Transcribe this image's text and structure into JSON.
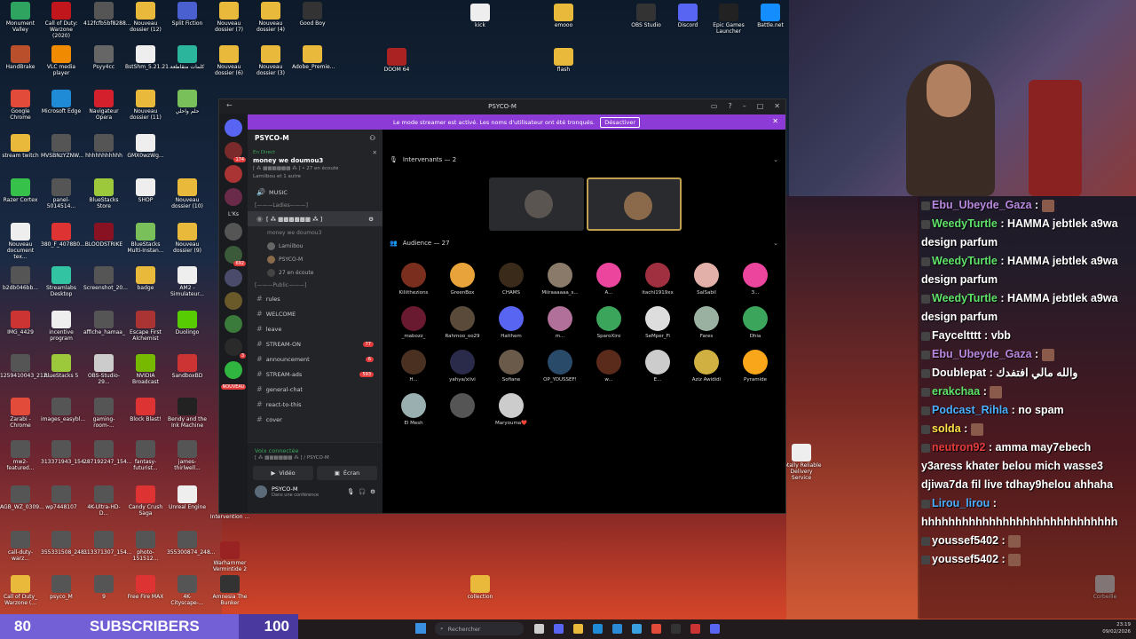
{
  "desktop_icons": [
    {
      "label": "Monument Valley",
      "color": "#2fa360"
    },
    {
      "label": "Call of Duty: Warzone (2020)",
      "color": "#c0161c"
    },
    {
      "label": "412fcfb5bf8288...",
      "color": "#555"
    },
    {
      "label": "Nouveau dossier (12)",
      "color": "#e8b93a"
    },
    {
      "label": "Split Fiction",
      "color": "#4a5fd0"
    },
    {
      "label": "Nouveau dossier (7)",
      "color": "#e8b93a"
    },
    {
      "label": "Nouveau dossier (4)",
      "color": "#e8b93a"
    },
    {
      "label": "Good Boy",
      "color": "#333"
    },
    {
      "label": "HandBrake",
      "color": "#b9502b"
    },
    {
      "label": "VLC media player",
      "color": "#f08a00"
    },
    {
      "label": "Psyy4cc",
      "color": "#666"
    },
    {
      "label": "BstShm_5.21.21...",
      "color": "#eee"
    },
    {
      "label": "كلمات متقاطعة",
      "color": "#2ab59c"
    },
    {
      "label": "Nouveau dossier (6)",
      "color": "#e8b93a"
    },
    {
      "label": "Nouveau dossier (3)",
      "color": "#e8b93a"
    },
    {
      "label": "Adobe_Premie...",
      "color": "#e8b93a"
    },
    {
      "label": "Google Chrome",
      "color": "#e24b3a"
    },
    {
      "label": "Microsoft Edge",
      "color": "#1f8ad6"
    },
    {
      "label": "Navigateur Opera",
      "color": "#d3202c"
    },
    {
      "label": "Nouveau dossier (11)",
      "color": "#e8b93a"
    },
    {
      "label": "حلم واحلي",
      "color": "#7ac05a"
    },
    {
      "label": "stream twitch",
      "color": "#e8b93a"
    },
    {
      "label": "MVSBNzYZNW...",
      "color": "#555"
    },
    {
      "label": "hhhhhhhhhhh",
      "color": "#555"
    },
    {
      "label": "GMX0wzWg...",
      "color": "#eee"
    },
    {
      "label": "Razer Cortex",
      "color": "#36c24a"
    },
    {
      "label": "panel-5014514...",
      "color": "#555"
    },
    {
      "label": "BlueStacks Store",
      "color": "#9cc93c"
    },
    {
      "label": "SHOP",
      "color": "#eee"
    },
    {
      "label": "Nouveau dossier (10)",
      "color": "#e8b93a"
    },
    {
      "label": "Nouveau document tex...",
      "color": "#eee"
    },
    {
      "label": "380_F_4078B0...",
      "color": "#d33"
    },
    {
      "label": "BLOODSTRIKE",
      "color": "#812"
    },
    {
      "label": "BlueStacks Multi-Instan...",
      "color": "#7ac05a"
    },
    {
      "label": "Nouveau dossier (9)",
      "color": "#e8b93a"
    },
    {
      "label": "b2db046bb...",
      "color": "#555"
    },
    {
      "label": "Streamlabs Desktop",
      "color": "#31c3a2"
    },
    {
      "label": "Screenshot_20...",
      "color": "#555"
    },
    {
      "label": "badge",
      "color": "#e8b93a"
    },
    {
      "label": "AM2 - Simulateur...",
      "color": "#eee"
    },
    {
      "label": "IMG_4429",
      "color": "#c33"
    },
    {
      "label": "incentive program",
      "color": "#eee"
    },
    {
      "label": "affiche_hamaa_",
      "color": "#555"
    },
    {
      "label": "Escape First Alchemist",
      "color": "#a33"
    },
    {
      "label": "Duolingo",
      "color": "#58cc02"
    },
    {
      "label": "1259410043_212...",
      "color": "#555"
    },
    {
      "label": "BlueStacks 5",
      "color": "#9cc93c"
    },
    {
      "label": "OBS-Studio-29...",
      "color": "#ccc"
    },
    {
      "label": "NVIDIA Broadcast",
      "color": "#76b900"
    },
    {
      "label": "SandboxBD",
      "color": "#c33"
    },
    {
      "label": "Zarabi - Chrome",
      "color": "#e24b3a"
    },
    {
      "label": "images_easybl...",
      "color": "#555"
    },
    {
      "label": "gaming-room-...",
      "color": "#555"
    },
    {
      "label": "Block Blast!",
      "color": "#d33"
    },
    {
      "label": "Bendy and the Ink Machine",
      "color": "#222"
    },
    {
      "label": "mw2-featured...",
      "color": "#555"
    },
    {
      "label": "313371943_154...",
      "color": "#555"
    },
    {
      "label": "287192247_154...",
      "color": "#555"
    },
    {
      "label": "fantasy-futurist...",
      "color": "#555"
    },
    {
      "label": "james-thirlwell...",
      "color": "#555"
    },
    {
      "label": "AGB_WZ_0309...",
      "color": "#555"
    },
    {
      "label": "wp7448107",
      "color": "#555"
    },
    {
      "label": "4K-Ultra-HD-D...",
      "color": "#555"
    },
    {
      "label": "Candy Crush Saga",
      "color": "#d33"
    },
    {
      "label": "Unreal Engine",
      "color": "#eee"
    },
    {
      "label": "call-duty-warz...",
      "color": "#555"
    },
    {
      "label": "355331508_248...",
      "color": "#555"
    },
    {
      "label": "313371307_154...",
      "color": "#555"
    },
    {
      "label": "photo-151512...",
      "color": "#555"
    },
    {
      "label": "355300874_248...",
      "color": "#555"
    },
    {
      "label": "Call of Duty_ Warzone (...",
      "color": "#e8b93a"
    },
    {
      "label": "psyco_M",
      "color": "#555"
    },
    {
      "label": "9",
      "color": "#555"
    },
    {
      "label": "Free Fire MAX",
      "color": "#d33"
    },
    {
      "label": "4K-Cityscape-...",
      "color": "#555"
    },
    {
      "label": "kick",
      "color": "#eee"
    },
    {
      "label": "emooo",
      "color": "#e8b93a"
    },
    {
      "label": "flash",
      "color": "#e8b93a"
    },
    {
      "label": "DOOM 64",
      "color": "#a22"
    },
    {
      "label": "OBS Studio",
      "color": "#333"
    },
    {
      "label": "Discord",
      "color": "#5865f2"
    },
    {
      "label": "Epic Games Launcher",
      "color": "#222"
    },
    {
      "label": "Battle.net",
      "color": "#148eff"
    },
    {
      "label": "Intervention ...",
      "color": "#555"
    },
    {
      "label": "Warhammer Vermintide 2",
      "color": "#922"
    },
    {
      "label": "Amnesia The Bunker",
      "color": "#333"
    },
    {
      "label": "collection",
      "color": "#e8b93a"
    },
    {
      "label": "Totally Reliable Delivery Service",
      "color": "#eee"
    },
    {
      "label": "Corbeille",
      "color": "#ccc"
    }
  ],
  "discord": {
    "window_title": "PSYCO-M",
    "banner_text": "Le mode streamer est activé. Les noms d'utilisateur ont été tronqués.",
    "banner_button": "Désactiver",
    "server_name": "PSYCO-M",
    "guild_labels": [
      "L'Ks",
      "NOUVEAU"
    ],
    "guild_badges": [
      "174",
      "692",
      "3"
    ],
    "event": {
      "live": "En Direct",
      "title": "money we doumou3",
      "host": "[ ⁂ ▩▩▩▩▩▩ ⁂ ] • 27 en écoute",
      "attendees": "Lamiibou et 1 autre"
    },
    "music_label": "MUSIC",
    "section_ladies": "[———Ladies———]",
    "voice_channel": {
      "name": "[ ⁂ ▩▩▩▩▩▩ ⁂ ]",
      "sub": "money we doumou3",
      "users": [
        "Lamiibou",
        "PSYCO-M",
        "27 en écoute"
      ]
    },
    "section_public": "[———Public———]",
    "channels": [
      {
        "name": "rules",
        "count": ""
      },
      {
        "name": "WELCOME",
        "count": ""
      },
      {
        "name": "leave",
        "count": ""
      },
      {
        "name": "STREAM-ON",
        "count": "77"
      },
      {
        "name": "announcement",
        "count": "6"
      },
      {
        "name": "STREAM-ads",
        "count": "593"
      },
      {
        "name": "general-chat",
        "count": ""
      },
      {
        "name": "react-to-this",
        "count": ""
      },
      {
        "name": "cover",
        "count": ""
      }
    ],
    "voice_connected": {
      "status": "Voix connectée",
      "where": "[ ⁂ ▩▩▩▩▩▩ ⁂ ] / PSYCO-M",
      "video": "Vidéo",
      "screen": "Écran"
    },
    "user": {
      "name": "PSYCO-M",
      "status": "Dans une conférence"
    },
    "speakers_header": "Intervenants — 2",
    "audience_header": "Audience — 27",
    "audience": [
      {
        "name": "Kiliithezions",
        "color": "#7a2e1e"
      },
      {
        "name": "GreenBox",
        "color": "#e8a43a"
      },
      {
        "name": "CHAMS",
        "color": "#3a2a1a"
      },
      {
        "name": "Miiraaaaaa_s...",
        "color": "#8a7a6a"
      },
      {
        "name": "A...",
        "color": "#eb459e"
      },
      {
        "name": "itachi1919xx",
        "color": "#a03040"
      },
      {
        "name": "SalSabil",
        "color": "#e2b0a8"
      },
      {
        "name": "3...",
        "color": "#eb459e"
      },
      {
        "name": "_mabozz_",
        "color": "#6a1a30"
      },
      {
        "name": "Rahmoo_oo29",
        "color": "#5a4a3a"
      },
      {
        "name": "Haithem",
        "color": "#5865f2"
      },
      {
        "name": "m...",
        "color": "#b0709a"
      },
      {
        "name": "SparoXiro",
        "color": "#3ba55c"
      },
      {
        "name": "SeMper_Fi",
        "color": "#ddd"
      },
      {
        "name": "Fares",
        "color": "#9ab0a0"
      },
      {
        "name": "Dhia",
        "color": "#3ba55c"
      },
      {
        "name": "H...",
        "color": "#4a3020"
      },
      {
        "name": "yahya/xiivi",
        "color": "#2a2a4a"
      },
      {
        "name": "Sofiane",
        "color": "#6a5a4a"
      },
      {
        "name": "OP_YOUSSEF!",
        "color": "#2a4a6a"
      },
      {
        "name": "w...",
        "color": "#5a2a1a"
      },
      {
        "name": "E...",
        "color": "#ccc"
      },
      {
        "name": "Aziz Awididi",
        "color": "#d0b040"
      },
      {
        "name": "Pyramide",
        "color": "#faa61a"
      },
      {
        "name": "El Mesh",
        "color": "#9ab0b0"
      },
      {
        "name": "",
        "color": "#555"
      },
      {
        "name": "Maryouma❤️",
        "color": "#ccc"
      }
    ]
  },
  "chat": [
    {
      "user": "Ebu_Ubeyde_Gaza",
      "text": "",
      "usercolor": "#b98ae0"
    },
    {
      "user": "WeedyTurtle",
      "text": "HAMMA jebtlek a9wa design parfum",
      "usercolor": "#5fe26a"
    },
    {
      "user": "WeedyTurtle",
      "text": "HAMMA jebtlek a9wa design parfum",
      "usercolor": "#5fe26a"
    },
    {
      "user": "WeedyTurtle",
      "text": "HAMMA jebtlek a9wa design parfum",
      "usercolor": "#5fe26a"
    },
    {
      "user": "Fayceltttt",
      "text": "vbb",
      "usercolor": "#ffffff"
    },
    {
      "user": "Ebu_Ubeyde_Gaza",
      "text": "",
      "usercolor": "#b98ae0"
    },
    {
      "user": "Doublepat",
      "text": "والله مالي افتفدك",
      "usercolor": "#ffffff"
    },
    {
      "user": "erakchaa",
      "text": "",
      "usercolor": "#5fe26a"
    },
    {
      "user": "Podcast_Rihla",
      "text": "no spam",
      "usercolor": "#4ab0ff"
    },
    {
      "user": "solda",
      "text": "",
      "usercolor": "#ffe14a"
    },
    {
      "user": "neutron92",
      "text": "amma may7ebech y3aress khater belou mich wasse3 djiwa7da fil live tdhay9helou ahhaha",
      "usercolor": "#e23c3c"
    },
    {
      "user": "Lirou_lirou",
      "text": "hhhhhhhhhhhhhhhhhhhhhhhhhhhhh",
      "usercolor": "#4ab0ff"
    },
    {
      "user": "youssef5402",
      "text": "",
      "usercolor": "#ffffff"
    },
    {
      "user": "youssef5402",
      "text": "",
      "usercolor": "#ffffff"
    }
  ],
  "subs_bar": {
    "current": "80",
    "label": "SUBSCRIBERS",
    "goal": "100",
    "progress": 0.8
  },
  "taskbar": {
    "search": "Rechercher",
    "time": "23:19",
    "date": "09/02/2026"
  }
}
